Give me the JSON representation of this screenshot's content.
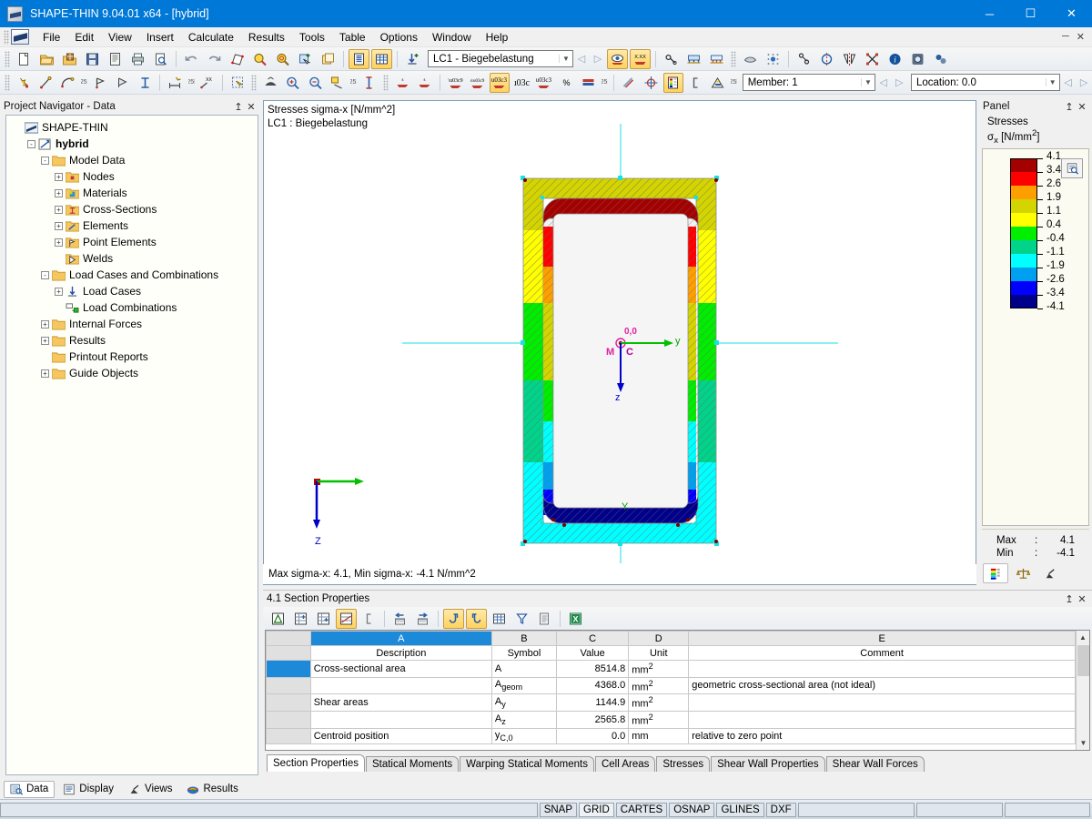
{
  "window": {
    "title": "SHAPE-THIN 9.04.01 x64 - [hybrid]",
    "minimize": "─",
    "maximize": "☐",
    "close": "✕"
  },
  "menu": {
    "items": [
      {
        "label": "File"
      },
      {
        "label": "Edit"
      },
      {
        "label": "View"
      },
      {
        "label": "Insert"
      },
      {
        "label": "Calculate"
      },
      {
        "label": "Results"
      },
      {
        "label": "Tools"
      },
      {
        "label": "Table"
      },
      {
        "label": "Options"
      },
      {
        "label": "Window"
      },
      {
        "label": "Help"
      }
    ],
    "mdi_minimize": "─",
    "mdi_close": "✕"
  },
  "toolbar1": {
    "loadcase_value": "LC1 - Biegebelastung",
    "dropdown_arrow": "▼",
    "prev_arrow": "◁",
    "next_arrow": "▷"
  },
  "toolbar2": {
    "member_label": "Member: 1",
    "location_label": "Location:  0.0",
    "dropdown_arrow": "▼",
    "prev_arrow": "◁",
    "next_arrow": "▷"
  },
  "navigator": {
    "caption": "Project Navigator - Data",
    "pin": "↥",
    "close": "✕",
    "tree": [
      {
        "label": "SHAPE-THIN",
        "indent": 0,
        "expander": "none",
        "icon": "app-icon",
        "bold": false
      },
      {
        "label": "hybrid",
        "indent": 1,
        "expander": "-",
        "icon": "model-icon",
        "bold": true
      },
      {
        "label": "Model Data",
        "indent": 2,
        "expander": "-",
        "icon": "folder-icon",
        "bold": false
      },
      {
        "label": "Nodes",
        "indent": 3,
        "expander": "+",
        "icon": "nodes-icon",
        "bold": false
      },
      {
        "label": "Materials",
        "indent": 3,
        "expander": "+",
        "icon": "materials-icon",
        "bold": false
      },
      {
        "label": "Cross-Sections",
        "indent": 3,
        "expander": "+",
        "icon": "cross-sections-icon",
        "bold": false
      },
      {
        "label": "Elements",
        "indent": 3,
        "expander": "+",
        "icon": "elements-icon",
        "bold": false
      },
      {
        "label": "Point Elements",
        "indent": 3,
        "expander": "+",
        "icon": "point-elements-icon",
        "bold": false
      },
      {
        "label": "Welds",
        "indent": 3,
        "expander": "none",
        "icon": "welds-icon",
        "bold": false
      },
      {
        "label": "Load Cases and Combinations",
        "indent": 2,
        "expander": "-",
        "icon": "folder-icon",
        "bold": false
      },
      {
        "label": "Load Cases",
        "indent": 3,
        "expander": "+",
        "icon": "load-cases-icon",
        "bold": false
      },
      {
        "label": "Load Combinations",
        "indent": 3,
        "expander": "none",
        "icon": "load-combinations-icon",
        "bold": false
      },
      {
        "label": "Internal Forces",
        "indent": 2,
        "expander": "+",
        "icon": "folder-icon",
        "bold": false
      },
      {
        "label": "Results",
        "indent": 2,
        "expander": "+",
        "icon": "folder-icon",
        "bold": false
      },
      {
        "label": "Printout Reports",
        "indent": 2,
        "expander": "none",
        "icon": "folder-icon",
        "bold": false
      },
      {
        "label": "Guide Objects",
        "indent": 2,
        "expander": "+",
        "icon": "folder-icon",
        "bold": false
      }
    ]
  },
  "viewport": {
    "title_line1": "Stresses sigma-x [N/mm^2]",
    "title_line2": "LC1 : Biegebelastung",
    "status": "Max sigma-x: 4.1, Min sigma-x: -4.1 N/mm^2",
    "axis_y_label": "Y",
    "axis_z_label": "Z",
    "centroid_label_c": "C",
    "centroid_label_m": "M",
    "centroid_label_top": "0,0",
    "local_y_label": "y",
    "local_z_label": "z"
  },
  "panel": {
    "caption": "Panel",
    "pin": "↥",
    "close": "✕",
    "heading": "Stresses",
    "unit_symbol": "σ",
    "unit_sub": "x",
    "unit_text": "[N/mm",
    "unit_exp": "2",
    "unit_close": "]",
    "max_key": "Max",
    "max_colon": ":",
    "max_value": "4.1",
    "min_key": "Min",
    "min_colon": ":",
    "min_value": "-4.1",
    "tick_values": [
      "4.1",
      "3.4",
      "2.6",
      "1.9",
      "1.1",
      "0.4",
      "-0.4",
      "-1.1",
      "-1.9",
      "-2.6",
      "-3.4",
      "-4.1"
    ],
    "band_colors": [
      "#a50000",
      "#ff0000",
      "#ff9e00",
      "#d4d400",
      "#ffff00",
      "#00ee00",
      "#00d48a",
      "#00ffff",
      "#00a0f0",
      "#0000ff",
      "#00008b"
    ]
  },
  "table_pane": {
    "caption": "4.1 Section Properties",
    "pin": "↥",
    "close": "✕",
    "column_letters": [
      "A",
      "B",
      "C",
      "D",
      "E"
    ],
    "sub_headers": [
      "Description",
      "Symbol",
      "Value",
      "Unit",
      "Comment"
    ],
    "rows": [
      {
        "selected": true,
        "description": "Cross-sectional area",
        "symbol": "A",
        "symbol_sub": "",
        "value": "8514.8",
        "unit": "mm",
        "unit_exp": "2",
        "comment": ""
      },
      {
        "selected": false,
        "description": "",
        "symbol": "A",
        "symbol_sub": "geom",
        "value": "4368.0",
        "unit": "mm",
        "unit_exp": "2",
        "comment": "geometric cross-sectional area (not ideal)"
      },
      {
        "selected": false,
        "description": "Shear areas",
        "symbol": "A",
        "symbol_sub": "y",
        "value": "1144.9",
        "unit": "mm",
        "unit_exp": "2",
        "comment": ""
      },
      {
        "selected": false,
        "description": "",
        "symbol": "A",
        "symbol_sub": "z",
        "value": "2565.8",
        "unit": "mm",
        "unit_exp": "2",
        "comment": ""
      },
      {
        "selected": false,
        "description": "Centroid position",
        "symbol": "y",
        "symbol_sub": "C,0",
        "value": "0.0",
        "unit": "mm",
        "unit_exp": "",
        "comment": "relative to zero point"
      }
    ],
    "scroll_up": "▲",
    "scroll_down": "▼",
    "sheet_tabs": [
      {
        "label": "Section Properties",
        "active": true
      },
      {
        "label": "Statical Moments",
        "active": false
      },
      {
        "label": "Warping Statical Moments",
        "active": false
      },
      {
        "label": "Cell Areas",
        "active": false
      },
      {
        "label": "Stresses",
        "active": false
      },
      {
        "label": "Shear Wall Properties",
        "active": false
      },
      {
        "label": "Shear Wall Forces",
        "active": false
      }
    ]
  },
  "nav_tabs": [
    {
      "label": "Data",
      "active": true,
      "icon": "data-icon"
    },
    {
      "label": "Display",
      "active": false,
      "icon": "display-icon"
    },
    {
      "label": "Views",
      "active": false,
      "icon": "views-icon"
    },
    {
      "label": "Results",
      "active": false,
      "icon": "results-icon"
    }
  ],
  "statusbar": {
    "cells": [
      {
        "label": "SNAP",
        "on": false
      },
      {
        "label": "GRID",
        "on": true
      },
      {
        "label": "CARTES",
        "on": false
      },
      {
        "label": "OSNAP",
        "on": false
      },
      {
        "label": "GLINES",
        "on": false
      },
      {
        "label": "DXF",
        "on": false
      }
    ]
  },
  "chart_data": {
    "type": "heatmap",
    "title": "Stresses sigma-x [N/mm^2]",
    "subtitle": "LC1 : Biegebelastung",
    "legend_title": "Stresses",
    "legend_unit": "σx [N/mm2]",
    "colorbar_breaks": [
      4.1,
      3.4,
      2.6,
      1.9,
      1.1,
      0.4,
      -0.4,
      -1.1,
      -1.9,
      -2.6,
      -3.4,
      -4.1
    ],
    "colorbar_colors": [
      "#a50000",
      "#ff0000",
      "#ff9e00",
      "#d4d400",
      "#ffff00",
      "#00ee00",
      "#00d48a",
      "#00ffff",
      "#00a0f0",
      "#0000ff",
      "#00008b"
    ],
    "max": 4.1,
    "min": -4.1,
    "unit": "N/mm^2"
  }
}
